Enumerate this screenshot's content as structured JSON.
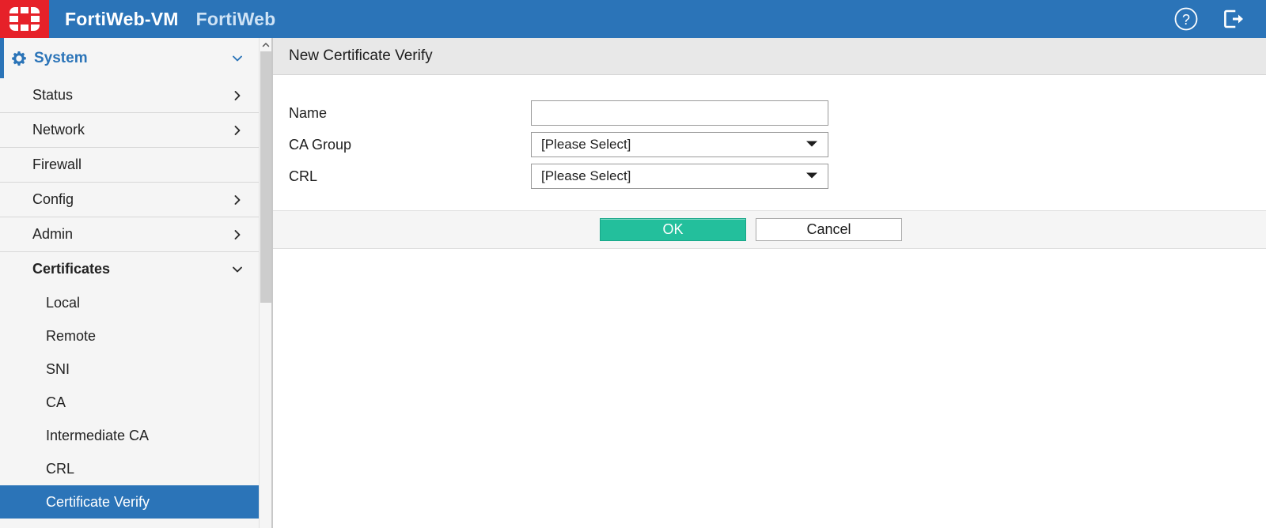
{
  "header": {
    "logo_icon": "fortinet-logo-icon",
    "product": "FortiWeb-VM",
    "brand": "FortiWeb",
    "help_icon": "help-circle-icon",
    "logout_icon": "logout-icon"
  },
  "sidebar": {
    "section": {
      "label": "System",
      "icon": "gear-icon",
      "chevron": "chevron-down-icon"
    },
    "items": [
      {
        "label": "Status",
        "chevron": "chevron-right-icon"
      },
      {
        "label": "Network",
        "chevron": "chevron-right-icon"
      },
      {
        "label": "Firewall",
        "chevron": ""
      },
      {
        "label": "Config",
        "chevron": "chevron-right-icon"
      },
      {
        "label": "Admin",
        "chevron": "chevron-right-icon"
      },
      {
        "label": "Certificates",
        "chevron": "chevron-down-icon"
      }
    ],
    "subitems": [
      {
        "label": "Local",
        "active": false
      },
      {
        "label": "Remote",
        "active": false
      },
      {
        "label": "SNI",
        "active": false
      },
      {
        "label": "CA",
        "active": false
      },
      {
        "label": "Intermediate CA",
        "active": false
      },
      {
        "label": "CRL",
        "active": false
      },
      {
        "label": "Certificate Verify",
        "active": true
      }
    ],
    "scrollbar": {
      "up_icon": "scroll-up-arrow-icon"
    }
  },
  "main": {
    "panel_title": "New Certificate Verify",
    "fields": [
      {
        "label": "Name",
        "type": "text",
        "value": "",
        "placeholder": ""
      },
      {
        "label": "CA Group",
        "type": "select",
        "value": "[Please Select]"
      },
      {
        "label": "CRL",
        "type": "select",
        "value": "[Please Select]"
      }
    ],
    "buttons": {
      "ok": "OK",
      "cancel": "Cancel"
    }
  },
  "colors": {
    "header_blue": "#2b74b8",
    "logo_red": "#e62129",
    "accent_blue": "#2b74b8",
    "ok_green": "#23bf9c",
    "panel_gray": "#e8e8e8",
    "sidebar_gray": "#f5f5f5"
  }
}
